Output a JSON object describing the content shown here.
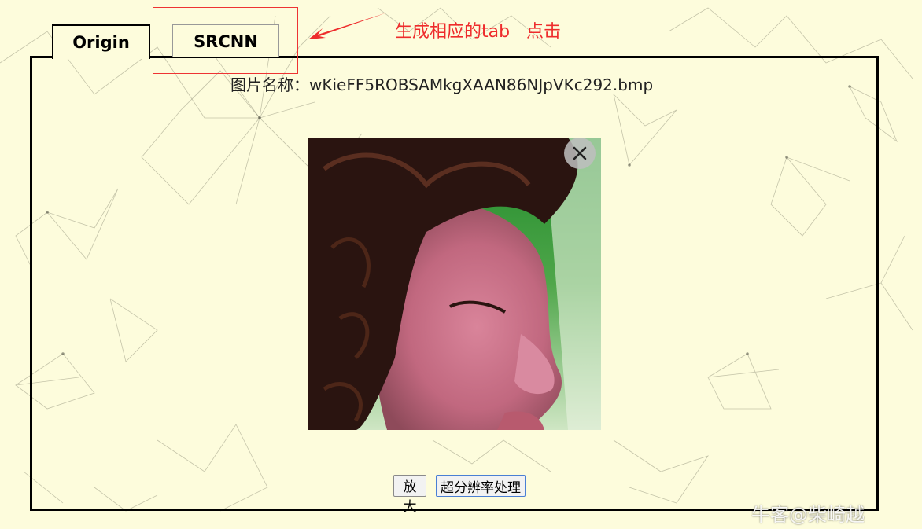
{
  "tabs": [
    {
      "label": "Origin",
      "active": true
    },
    {
      "label": "SRCNN",
      "active": false
    }
  ],
  "annotation": {
    "text": "生成相应的tab   点击",
    "color": "#ee2c2c"
  },
  "file": {
    "label": "图片名称：wKieFF5ROBSAMkgXAAN86NJpVKc292.bmp"
  },
  "buttons": {
    "zoom_label": "放大",
    "super_resolution_label": "超分辨率处理"
  },
  "image": {
    "close_icon": "close-icon",
    "subject": "photo"
  },
  "watermark": "牛客@柴崎越"
}
